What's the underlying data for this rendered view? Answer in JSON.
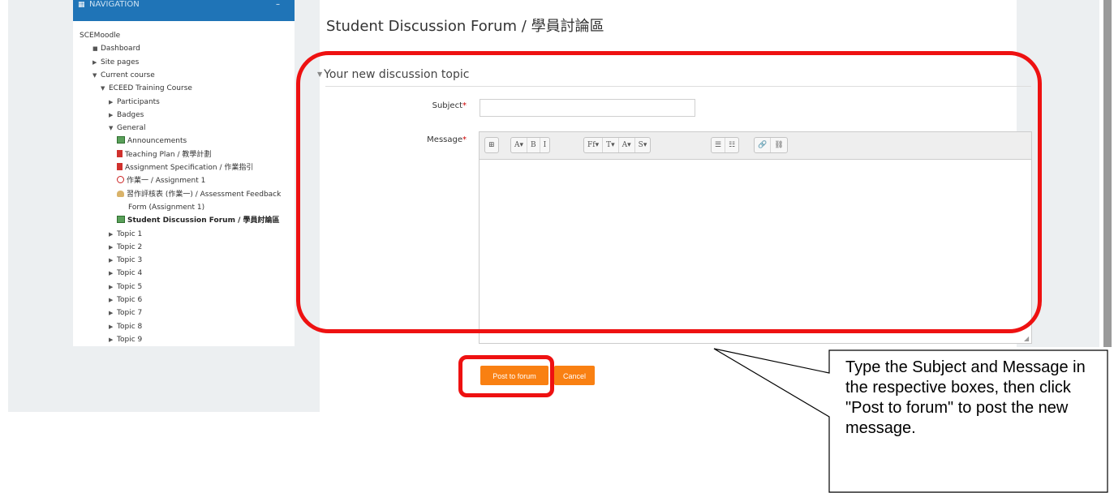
{
  "navigation": {
    "header": "NAVIGATION",
    "items": [
      {
        "label": "SCEMoodle",
        "marker": "none",
        "icon": "none",
        "bold": false
      },
      {
        "label": "Dashboard",
        "marker": "bullet",
        "icon": "none",
        "bold": false
      },
      {
        "label": "Site pages",
        "marker": "collapsed",
        "icon": "none",
        "bold": false
      },
      {
        "label": "Current course",
        "marker": "expanded",
        "icon": "none",
        "bold": false
      },
      {
        "label": "ECEED Training Course",
        "marker": "expanded",
        "icon": "none",
        "bold": false
      },
      {
        "label": "Participants",
        "marker": "collapsed",
        "icon": "none",
        "bold": false
      },
      {
        "label": "Badges",
        "marker": "collapsed",
        "icon": "none",
        "bold": false
      },
      {
        "label": "General",
        "marker": "expanded",
        "icon": "none",
        "bold": false
      },
      {
        "label": "Announcements",
        "marker": "none",
        "icon": "forum-icon",
        "bold": false
      },
      {
        "label": "Teaching Plan / 教學計劃",
        "marker": "none",
        "icon": "pdf-icon",
        "bold": false
      },
      {
        "label": "Assignment Specification / 作業指引",
        "marker": "none",
        "icon": "pdf-icon",
        "bold": false
      },
      {
        "label": "作業一 / Assignment 1",
        "marker": "none",
        "icon": "assignment-icon",
        "bold": false
      },
      {
        "label": "習作評核表 (作業一) / Assessment Feedback",
        "marker": "none",
        "icon": "feedback-icon",
        "bold": false
      },
      {
        "label": "Form (Assignment 1)",
        "marker": "none",
        "icon": "none",
        "bold": false
      },
      {
        "label": "Student Discussion Forum / 學員討論區",
        "marker": "none",
        "icon": "forum-icon",
        "bold": true
      },
      {
        "label": "Topic 1",
        "marker": "collapsed",
        "icon": "none",
        "bold": false
      },
      {
        "label": "Topic 2",
        "marker": "collapsed",
        "icon": "none",
        "bold": false
      },
      {
        "label": "Topic 3",
        "marker": "collapsed",
        "icon": "none",
        "bold": false
      },
      {
        "label": "Topic 4",
        "marker": "collapsed",
        "icon": "none",
        "bold": false
      },
      {
        "label": "Topic 5",
        "marker": "collapsed",
        "icon": "none",
        "bold": false
      },
      {
        "label": "Topic 6",
        "marker": "collapsed",
        "icon": "none",
        "bold": false
      },
      {
        "label": "Topic 7",
        "marker": "collapsed",
        "icon": "none",
        "bold": false
      },
      {
        "label": "Topic 8",
        "marker": "collapsed",
        "icon": "none",
        "bold": false
      },
      {
        "label": "Topic 9",
        "marker": "collapsed",
        "icon": "none",
        "bold": false
      }
    ]
  },
  "main": {
    "title": "Student Discussion Forum / 學員討論區",
    "form": {
      "legend": "Your new discussion topic",
      "subject_label": "Subject",
      "subject_value": "",
      "message_label": "Message",
      "required_marker": "*",
      "toolbar": [
        [
          "⊞"
        ],
        [
          "A▾",
          "B",
          "I"
        ],
        [
          "Ff▾",
          "T▾",
          "A▾",
          "S▾"
        ],
        [
          "☰",
          "☷"
        ],
        [
          "🔗",
          "⛓"
        ]
      ],
      "toolbar_icons": [
        "toolbar-toggle-icon",
        "style-icon",
        "bold-icon",
        "italic-icon",
        "font-family-icon",
        "font-size-icon",
        "font-color-icon",
        "background-color-icon",
        "unordered-list-icon",
        "ordered-list-icon",
        "link-icon",
        "unlink-icon"
      ],
      "post_button": "Post to forum",
      "cancel_button": "Cancel"
    }
  },
  "callout": {
    "text": "Type the Subject and Message in the respective boxes, then click \"Post to forum\" to post the new message."
  },
  "colors": {
    "nav_header": "#1f74b7",
    "button": "#f98012",
    "highlight": "#ee1111",
    "page_bg": "#eceff1"
  }
}
